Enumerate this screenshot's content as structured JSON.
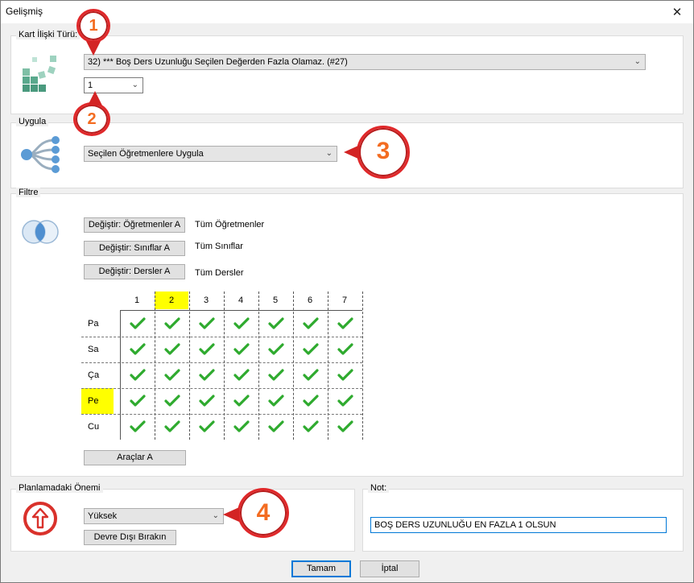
{
  "window": {
    "title": "Gelişmiş",
    "close_glyph": "✕"
  },
  "card_relation": {
    "group_label": "Kart İlişki Türü:",
    "type_value": "32) *** Boş Ders Uzunluğu Seçilen Değerden Fazla Olamaz. (#27)",
    "count_value": "1"
  },
  "apply": {
    "group_label": "Uygula",
    "value": "Seçilen Öğretmenlere Uygula"
  },
  "filter": {
    "group_label": "Filtre",
    "buttons": [
      {
        "label": "Değiştir: Öğretmenler A",
        "value": "Tüm Öğretmenler"
      },
      {
        "label": "Değiştir: Sınıflar A",
        "value": "Tüm Sınıflar"
      },
      {
        "label": "Değiştir: Dersler A",
        "value": "Tüm Dersler"
      }
    ],
    "grid": {
      "columns": [
        "1",
        "2",
        "3",
        "4",
        "5",
        "6",
        "7"
      ],
      "rows": [
        "Pa",
        "Sa",
        "Ça",
        "Pe",
        "Cu"
      ],
      "highlight_column": "2",
      "highlight_row": "Pe",
      "highlight_color": "#ffff00",
      "check_color": "#2eaa2e",
      "all_checked": true
    },
    "tools_button": "Araçlar A"
  },
  "priority": {
    "group_label": "Planlamadaki Önemi",
    "value": "Yüksek",
    "disable_button": "Devre Dışı Bırakın"
  },
  "note": {
    "group_label": "Not:",
    "value": "BOŞ DERS UZUNLUĞU EN FAZLA 1 OLSUN"
  },
  "footer": {
    "ok": "Tamam",
    "cancel": "İptal"
  },
  "callouts": [
    "1",
    "2",
    "3",
    "4"
  ],
  "colors": {
    "callout_ring": "#e0282a",
    "callout_digit": "#f36c21",
    "accent": "#0078d7"
  },
  "icons": {
    "card_relation": "blocks-icon",
    "apply": "tree-icon",
    "filter": "venn-icon",
    "priority": "up-arrow-circle-icon"
  }
}
